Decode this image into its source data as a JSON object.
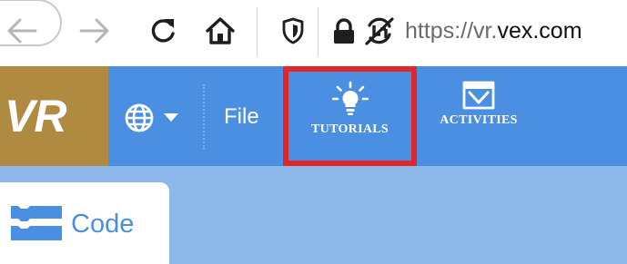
{
  "browser": {
    "url_prefix": "https://vr.",
    "url_domain": "vex.com",
    "icons": [
      "back-arrow-icon",
      "forward-arrow-icon",
      "reload-icon",
      "home-icon",
      "tracking-shield-icon",
      "lock-icon",
      "permissions-icon"
    ]
  },
  "toolbar": {
    "logo": "VR",
    "language_icon": "globe-icon",
    "file_label": "File",
    "tabs": [
      {
        "label": "TUTORIALS",
        "icon": "lightbulb-icon",
        "highlighted": true
      },
      {
        "label": "ACTIVITIES",
        "icon": "activities-icon",
        "highlighted": false
      }
    ]
  },
  "workspace": {
    "code_tab_label": "Code",
    "code_tab_icon": "code-blocks-icon"
  },
  "colors": {
    "toolbar_blue": "#4a8fe2",
    "logo_gold": "#b08a41",
    "workspace_blue": "#8fb8ea",
    "highlight_red": "#e0262b"
  }
}
